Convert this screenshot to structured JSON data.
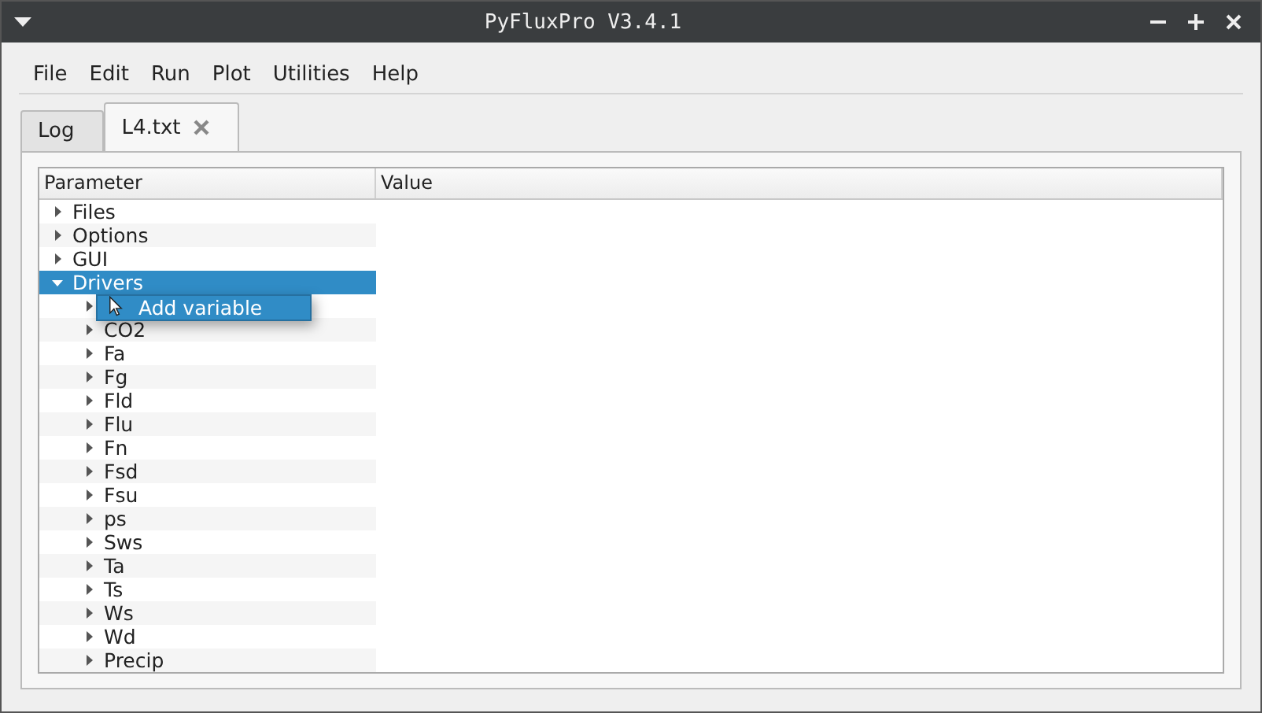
{
  "window": {
    "title": "PyFluxPro V3.4.1"
  },
  "menu": [
    "File",
    "Edit",
    "Run",
    "Plot",
    "Utilities",
    "Help"
  ],
  "tabs": [
    {
      "label": "Log",
      "selected": false,
      "closable": false
    },
    {
      "label": "L4.txt",
      "selected": true,
      "closable": true
    }
  ],
  "tree": {
    "columns": [
      "Parameter",
      "Value"
    ],
    "items": [
      {
        "label": "Files",
        "expanded": false,
        "selected": false
      },
      {
        "label": "Options",
        "expanded": false,
        "selected": false
      },
      {
        "label": "GUI",
        "expanded": false,
        "selected": false
      },
      {
        "label": "Drivers",
        "expanded": true,
        "selected": true,
        "children": [
          {
            "expanded": false,
            "selected": false
          },
          {
            "label": "CO2",
            "expanded": false,
            "selected": false
          },
          {
            "label": "Fa",
            "expanded": false,
            "selected": false
          },
          {
            "label": "Fg",
            "expanded": false,
            "selected": false
          },
          {
            "label": "Fld",
            "expanded": false,
            "selected": false
          },
          {
            "label": "Flu",
            "expanded": false,
            "selected": false
          },
          {
            "label": "Fn",
            "expanded": false,
            "selected": false
          },
          {
            "label": "Fsd",
            "expanded": false,
            "selected": false
          },
          {
            "label": "Fsu",
            "expanded": false,
            "selected": false
          },
          {
            "label": "ps",
            "expanded": false,
            "selected": false
          },
          {
            "label": "Sws",
            "expanded": false,
            "selected": false
          },
          {
            "label": "Ta",
            "expanded": false,
            "selected": false
          },
          {
            "label": "Ts",
            "expanded": false,
            "selected": false
          },
          {
            "label": "Ws",
            "expanded": false,
            "selected": false
          },
          {
            "label": "Wd",
            "expanded": false,
            "selected": false
          },
          {
            "label": "Precip",
            "expanded": false,
            "selected": false
          }
        ]
      }
    ]
  },
  "context_menu": {
    "items": [
      "Add variable"
    ]
  }
}
